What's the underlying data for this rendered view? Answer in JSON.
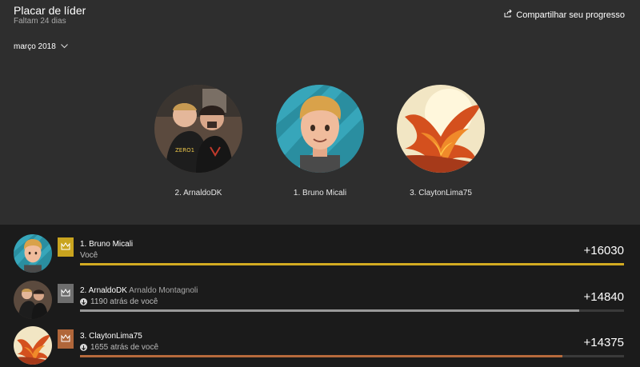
{
  "header": {
    "title": "Placar de líder",
    "subtitle": "Faltam 24 dias",
    "share_label": "Compartilhar seu progresso",
    "month_label": "março 2018"
  },
  "podium": [
    {
      "label": "2. ArnaldoDK",
      "avatar": "photo-two-men"
    },
    {
      "label": "1. Bruno Micali",
      "avatar": "cartoon-avatar"
    },
    {
      "label": "3. ClaytonLima75",
      "avatar": "phoenix-art"
    }
  ],
  "rows": [
    {
      "rank_name": "1. Bruno Micali",
      "full_name": "",
      "sub": "Você",
      "score": "+16030",
      "progress": 1.0,
      "badge_color": "#c9a41f",
      "bar_color": "#d3ab22",
      "show_arrow": false
    },
    {
      "rank_name": "2. ArnaldoDK",
      "full_name": "Arnaldo Montagnoli",
      "sub": "1190 atrás de você",
      "score": "+14840",
      "progress": 0.917,
      "badge_color": "#6e6e6e",
      "bar_color": "#9a9a9a",
      "show_arrow": true
    },
    {
      "rank_name": "3. ClaytonLima75",
      "full_name": "",
      "sub": "1655 atrás de você",
      "score": "+14375",
      "progress": 0.887,
      "badge_color": "#b0663a",
      "bar_color": "#b66a3c",
      "show_arrow": true
    }
  ]
}
